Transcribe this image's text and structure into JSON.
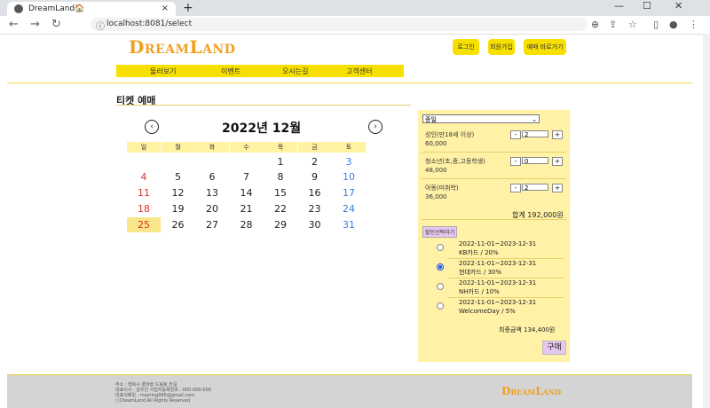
{
  "browser": {
    "tab_title": "DreamLand🏠",
    "tab_close": "×",
    "new_tab": "+",
    "url": "localhost:8081/select",
    "win_min": "—",
    "win_max": "☐",
    "win_close": "✕",
    "back": "←",
    "forward": "→",
    "reload": "↻",
    "info": "ⓘ",
    "zoom": "⊕",
    "share": "⇪",
    "bookmark": "☆",
    "sidebar": "▯",
    "profile": "●",
    "menu": "⋮"
  },
  "header": {
    "logo": "DreamLand",
    "login": "로그인",
    "signup": "회원가입",
    "quick_book": "예매 바로가기",
    "menu": [
      "둘러보기",
      "이벤트",
      "오시는길",
      "고객센터"
    ]
  },
  "page": {
    "title": "티켓 예매"
  },
  "calendar": {
    "title": "2022년 12월",
    "prev": "‹",
    "next": "›",
    "weekdays": [
      "일",
      "월",
      "화",
      "수",
      "목",
      "금",
      "토"
    ],
    "days": [
      "1",
      "2",
      "3",
      "4",
      "5",
      "6",
      "7",
      "8",
      "9",
      "10",
      "11",
      "12",
      "13",
      "14",
      "15",
      "16",
      "17",
      "18",
      "19",
      "20",
      "21",
      "22",
      "23",
      "24",
      "25",
      "26",
      "27",
      "28",
      "29",
      "30",
      "31"
    ],
    "selected_day": "25"
  },
  "booking": {
    "type_select": "종일",
    "tickets": [
      {
        "label": "성인(만18세 이상)",
        "qty": "2",
        "price": "60,000"
      },
      {
        "label": "청소년(초,중,고등학생)",
        "qty": "0",
        "price": "48,000"
      },
      {
        "label": "아동(미취학)",
        "qty": "2",
        "price": "36,000"
      }
    ],
    "minus": "-",
    "plus": "+",
    "total": "합계 192,000원",
    "discount_button": "할인선택하기",
    "discounts": [
      {
        "period": "2022-11-01~2023-12-31",
        "name": "KB카드 / 20%"
      },
      {
        "period": "2022-11-01~2023-12-31",
        "name": "현대카드 / 30%"
      },
      {
        "period": "2022-11-01~2023-12-31",
        "name": "NH카드 / 10%"
      },
      {
        "period": "2022-11-01~2023-12-31",
        "name": "WelcomeDay / 5%"
      }
    ],
    "selected_discount": 1,
    "final": "최종금액 134,400원",
    "buy": "구매"
  },
  "footer": {
    "lines": [
      "주소 : 행복시 꿈마을 드림로 한길",
      "대표이사 : 김우진  사업자등록번호 : 000-000-000",
      "대표이메일 : mspring995@gmail.com",
      "ⓒDreamLand.All Rights Reserved"
    ],
    "logo": "DreamLand"
  },
  "colors": {
    "accent_yellow": "#f7e000",
    "panel": "#fff1a6",
    "logo": "#f0a020",
    "holiday_red": "#e03030",
    "saturday_blue": "#3b7de6"
  }
}
